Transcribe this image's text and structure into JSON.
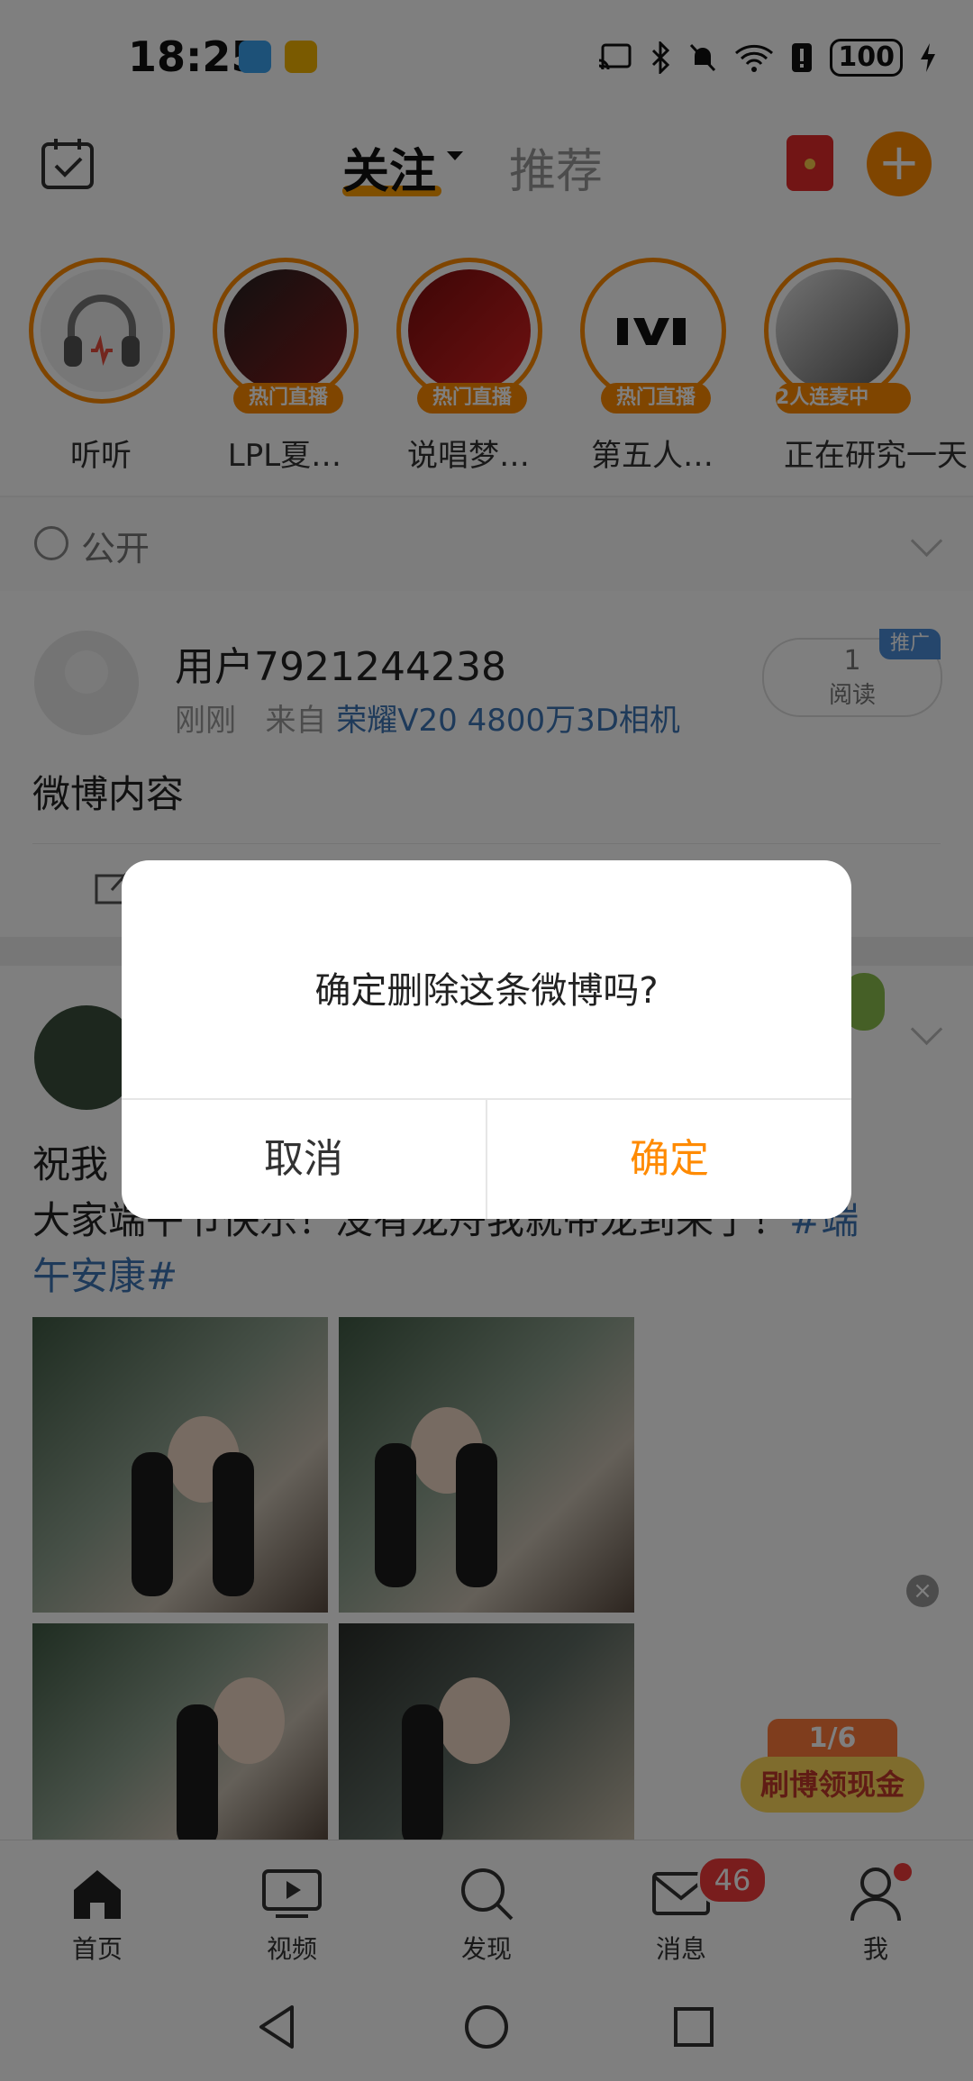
{
  "status_bar": {
    "time": "18:25",
    "battery": "100"
  },
  "header": {
    "tab_follow": "关注",
    "tab_recommend": "推荐"
  },
  "stories": [
    {
      "name": "听听",
      "badge": ""
    },
    {
      "name": "LPL夏…",
      "badge": "热门直播"
    },
    {
      "name": "说唱梦…",
      "badge": "热门直播"
    },
    {
      "name": "第五人…",
      "badge": "热门直播"
    },
    {
      "name": "正在研究一天",
      "badge": "2人连麦中"
    }
  ],
  "visibility": {
    "label": "公开"
  },
  "post1": {
    "username": "用户7921244238",
    "time": "刚刚",
    "from_prefix": "来自",
    "source": "荣耀V20 4800万3D相机",
    "read_count": "1",
    "read_label": "阅读",
    "promo": "推广",
    "content": "微博内容"
  },
  "post2": {
    "text_line1": "祝我",
    "text_line2": "大家端午节快乐！没有龙舟我就带龙到来了！",
    "hashtag_part1": "#端",
    "hashtag_part2": "午安康#"
  },
  "cash_widget": {
    "progress": "1/6",
    "label": "刷博领现金"
  },
  "tabbar": {
    "home": "首页",
    "video": "视频",
    "discover": "发现",
    "messages": "消息",
    "me": "我",
    "message_badge": "46"
  },
  "dialog": {
    "message": "确定删除这条微博吗?",
    "cancel": "取消",
    "confirm": "确定"
  },
  "colors": {
    "accent": "#ff8a00",
    "link": "#3d74b5",
    "badge_red": "#f23b3b"
  }
}
